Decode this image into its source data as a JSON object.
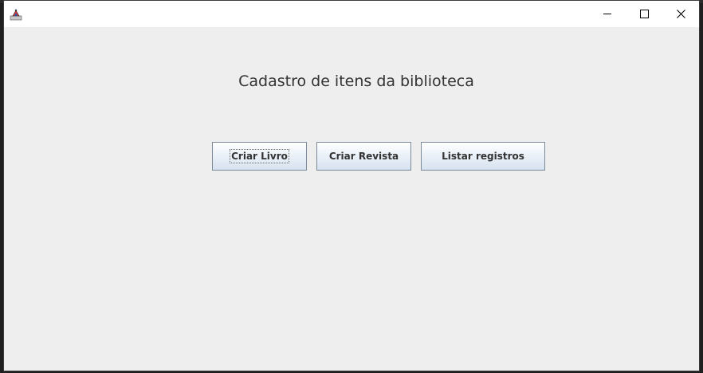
{
  "window": {
    "icon": "java-app-icon",
    "controls": {
      "minimize": "minimize-icon",
      "maximize": "maximize-icon",
      "close": "close-icon"
    }
  },
  "main": {
    "heading": "Cadastro de itens da biblioteca",
    "buttons": [
      {
        "label": "Criar Livro",
        "focused": true
      },
      {
        "label": "Criar Revista",
        "focused": false
      },
      {
        "label": "Listar registros",
        "focused": false
      }
    ]
  },
  "colors": {
    "background": "#eeeeee",
    "titlebar": "#ffffff",
    "button_border": "#7a8a99",
    "text": "#333333"
  }
}
